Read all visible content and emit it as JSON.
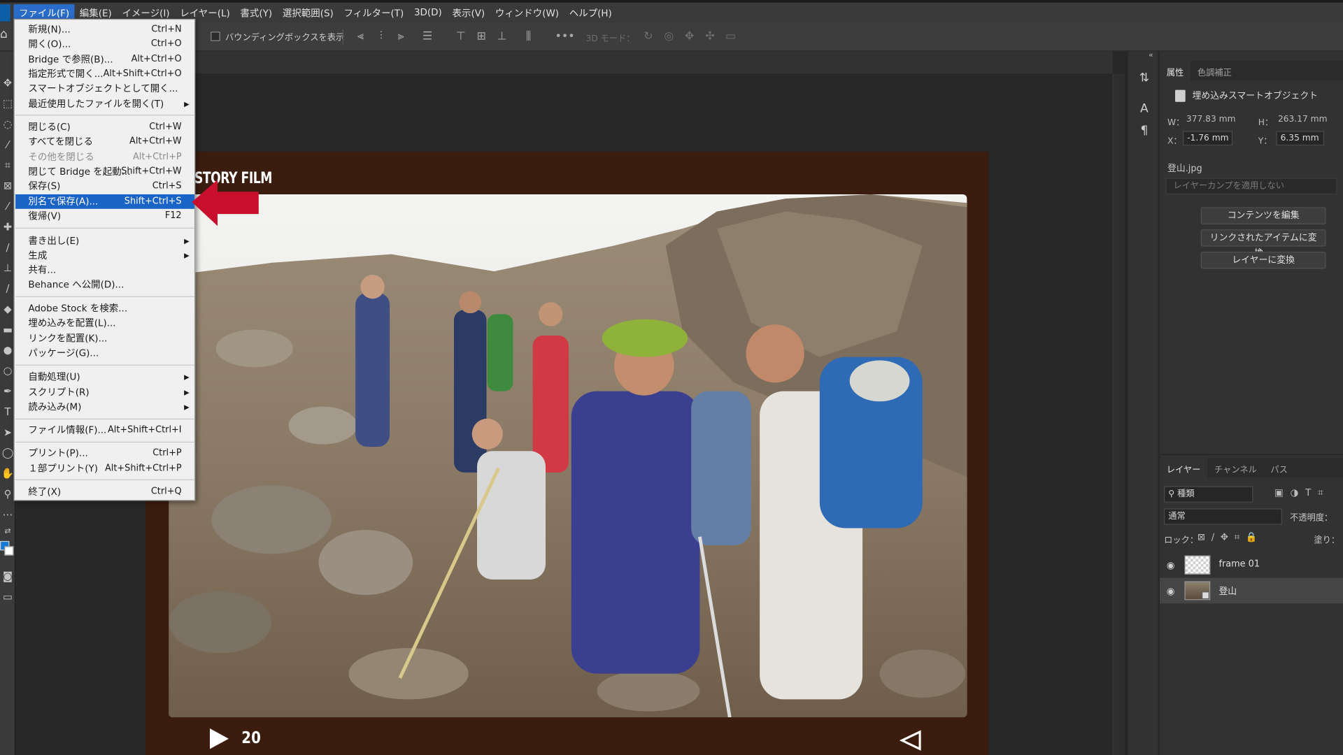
{
  "menubar": {
    "items": [
      "ファイル(F)",
      "編集(E)",
      "イメージ(I)",
      "レイヤー(L)",
      "書式(Y)",
      "選択範囲(S)",
      "フィルター(T)",
      "3D(D)",
      "表示(V)",
      "ウィンドウ(W)",
      "ヘルプ(H)"
    ]
  },
  "options_bar": {
    "bounding_box_label": "バウンディングボックスを表示",
    "mode_3d_label": "3D モード："
  },
  "file_menu": {
    "items": [
      {
        "label": "新規(N)...",
        "shortcut": "Ctrl+N"
      },
      {
        "label": "開く(O)...",
        "shortcut": "Ctrl+O"
      },
      {
        "label": "Bridge で参照(B)...",
        "shortcut": "Alt+Ctrl+O"
      },
      {
        "label": "指定形式で開く...",
        "shortcut": "Alt+Shift+Ctrl+O"
      },
      {
        "label": "スマートオブジェクトとして開く...",
        "shortcut": ""
      },
      {
        "label": "最近使用したファイルを開く(T)",
        "shortcut": ""
      },
      {
        "label": "閉じる(C)",
        "shortcut": "Ctrl+W"
      },
      {
        "label": "すべてを閉じる",
        "shortcut": "Alt+Ctrl+W"
      },
      {
        "label": "その他を閉じる",
        "shortcut": "Alt+Ctrl+P"
      },
      {
        "label": "閉じて Bridge を起動...",
        "shortcut": "Shift+Ctrl+W"
      },
      {
        "label": "保存(S)",
        "shortcut": "Ctrl+S"
      },
      {
        "label": "別名で保存(A)...",
        "shortcut": "Shift+Ctrl+S"
      },
      {
        "label": "復帰(V)",
        "shortcut": "F12"
      },
      {
        "label": "書き出し(E)",
        "shortcut": ""
      },
      {
        "label": "生成",
        "shortcut": ""
      },
      {
        "label": "共有...",
        "shortcut": ""
      },
      {
        "label": "Behance へ公開(D)...",
        "shortcut": ""
      },
      {
        "label": "Adobe Stock を検索...",
        "shortcut": ""
      },
      {
        "label": "埋め込みを配置(L)...",
        "shortcut": ""
      },
      {
        "label": "リンクを配置(K)...",
        "shortcut": ""
      },
      {
        "label": "パッケージ(G)...",
        "shortcut": ""
      },
      {
        "label": "自動処理(U)",
        "shortcut": ""
      },
      {
        "label": "スクリプト(R)",
        "shortcut": ""
      },
      {
        "label": "読み込み(M)",
        "shortcut": ""
      },
      {
        "label": "ファイル情報(F)...",
        "shortcut": "Alt+Shift+Ctrl+I"
      },
      {
        "label": "プリント(P)...",
        "shortcut": "Ctrl+P"
      },
      {
        "label": "１部プリント(Y)",
        "shortcut": "Alt+Shift+Ctrl+P"
      },
      {
        "label": "終了(X)",
        "shortcut": "Ctrl+Q"
      }
    ]
  },
  "canvas": {
    "frame_title": "STORY FILM",
    "frame_number": "20"
  },
  "properties": {
    "tabs": [
      "属性",
      "色調補正"
    ],
    "object_type": "埋め込みスマートオブジェクト",
    "w_label": "W：",
    "w_value": "377.83 mm",
    "h_label": "H：",
    "h_value": "263.17 mm",
    "x_label": "X：",
    "x_value": "-1.76 mm",
    "y_label": "Y：",
    "y_value": "6.35 mm",
    "filename": "登山.jpg",
    "layer_comp_placeholder": "レイヤーカンプを適用しない",
    "buttons": [
      "コンテンツを編集",
      "リンクされたアイテムに変換...",
      "レイヤーに変換"
    ]
  },
  "layers": {
    "tabs": [
      "レイヤー",
      "チャンネル",
      "パス"
    ],
    "filter_kind": "種類",
    "blend_mode": "通常",
    "opacity_label": "不透明度：",
    "lock_label": "ロック：",
    "fill_label": "塗り：",
    "items": [
      {
        "name": "frame 01",
        "selected": false
      },
      {
        "name": "登山",
        "selected": true
      }
    ]
  },
  "colors": {
    "menu_highlight": "#1a64c8",
    "frame_brown": "#3a1d0e",
    "arrow_red": "#c8102e",
    "foreground_swatch": "#1679d8"
  }
}
